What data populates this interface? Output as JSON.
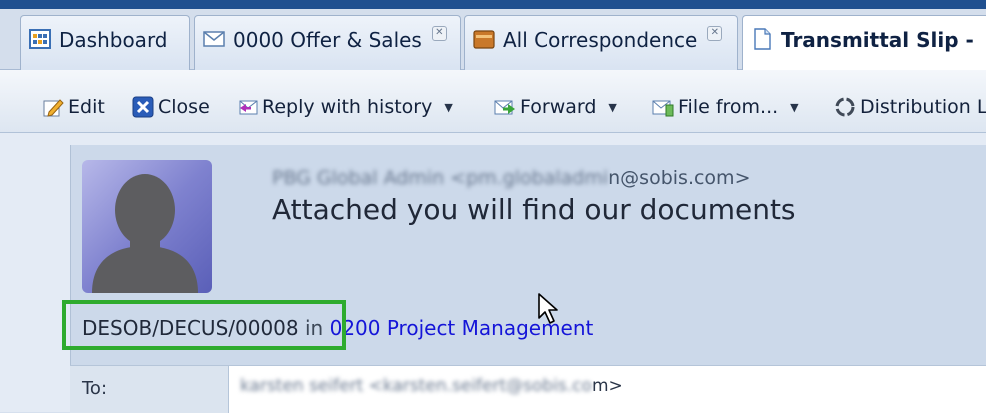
{
  "tabs": [
    {
      "label": "Dashboard",
      "icon": "dashboard-icon"
    },
    {
      "label": "0000 Offer & Sales",
      "icon": "envelope-icon"
    },
    {
      "label": "All Correspondence",
      "icon": "cabinet-icon"
    },
    {
      "label": "Transmittal Slip -",
      "icon": "document-icon"
    }
  ],
  "toolbar": {
    "edit": "Edit",
    "close": "Close",
    "reply_with_history": "Reply with history",
    "forward": "Forward",
    "file_from": "File from...",
    "distribution": "Distribution L"
  },
  "message": {
    "sender_blurred": "PBG Global Admin <pm.globaladmi",
    "sender_visible": "n@sobis.com>",
    "subject": "Attached you will find our documents",
    "reference": "DESOB/DECUS/00008",
    "in_word": "in",
    "project_link": "0200 Project Management",
    "to_label": "To:",
    "to_value_blurred": "karsten seifert <karsten.seifert@sobis.co",
    "to_value_visible": "m>"
  },
  "colors": {
    "highlight": "#2eab2e",
    "link": "#1515d8",
    "topline": "#1f4f8f"
  }
}
